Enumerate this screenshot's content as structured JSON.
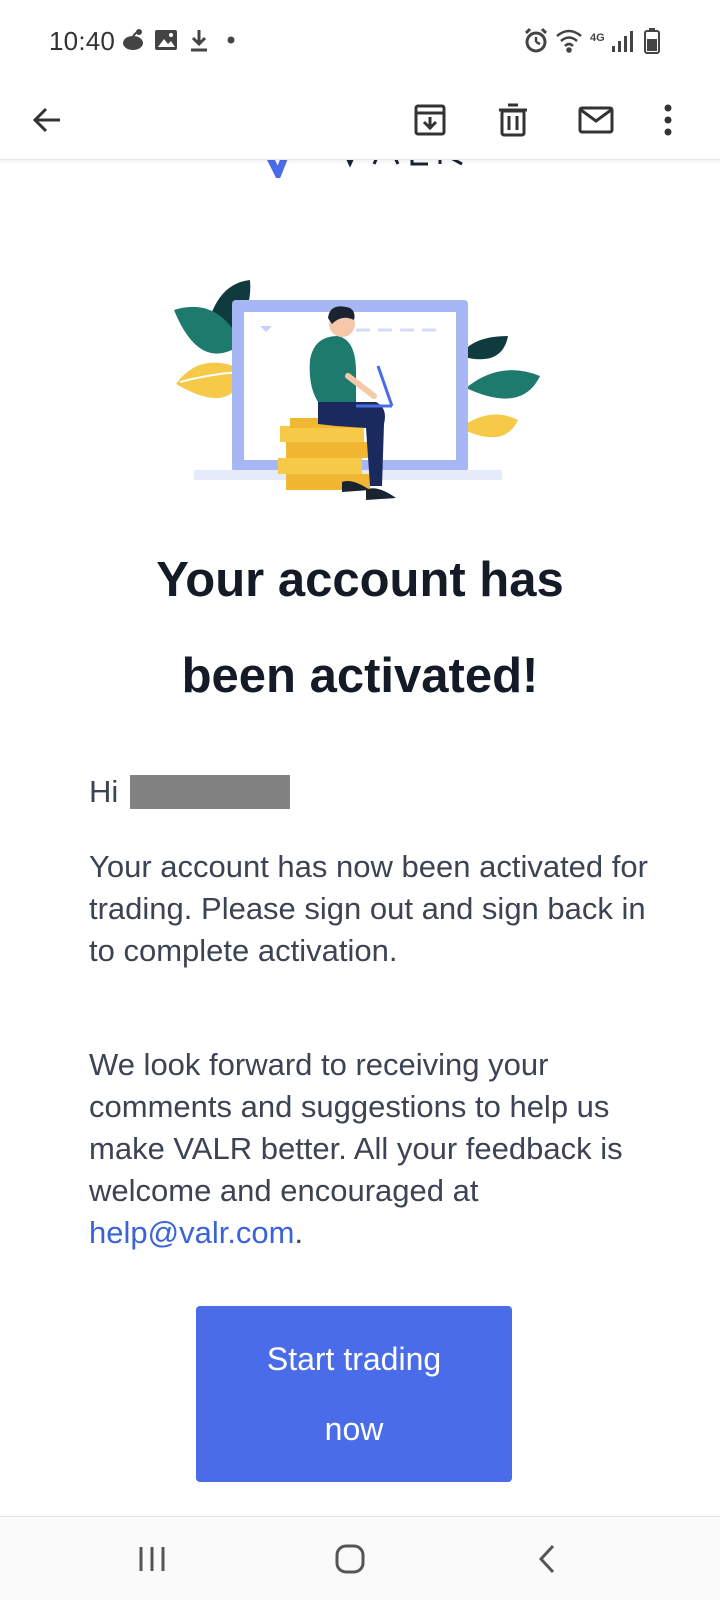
{
  "status_bar": {
    "time": "10:40",
    "network_label": "4G",
    "left_icons": [
      "reddit-icon",
      "image-icon",
      "download-icon",
      "dot-icon"
    ],
    "right_icons": [
      "alarm-icon",
      "wifi-icon",
      "network-4g-icon",
      "signal-icon",
      "battery-icon"
    ]
  },
  "app_bar": {
    "icons": [
      "back-arrow-icon",
      "archive-icon",
      "delete-icon",
      "mark-unread-icon",
      "more-vert-icon"
    ]
  },
  "email": {
    "headline_line1": "Your account has",
    "headline_line2": "been activated!",
    "greeting": "Hi",
    "paragraph1": "Your account has now been activated for trading. Please sign out and sign back in to complete activation.",
    "paragraph2_prefix": "We look forward to receiving your comments and suggestions to help us make VALR better.  All your feedback is welcome and encouraged at ",
    "paragraph2_link": "help@valr.com",
    "paragraph2_suffix": ".",
    "cta_line1": "Start trading",
    "cta_line2": "now"
  },
  "colors": {
    "accent": "#4a6ce8",
    "link": "#3b63d8",
    "leaf_green": "#1f7a6e",
    "leaf_dark": "#0f3b3f",
    "leaf_yellow": "#f7c948",
    "monitor": "#a7b6f5"
  },
  "nav_bar": {
    "icons": [
      "recents-icon",
      "home-icon",
      "back-icon"
    ]
  }
}
